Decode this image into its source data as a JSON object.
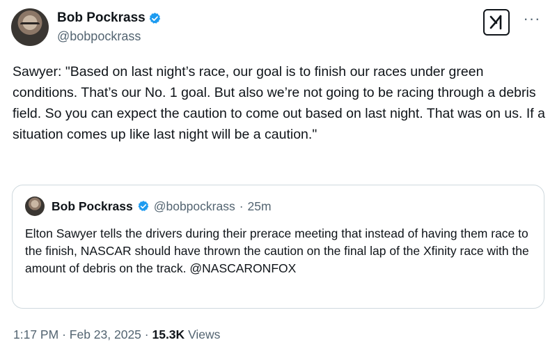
{
  "author": {
    "display_name": "Bob Pockrass",
    "handle": "@bobpockrass"
  },
  "tweet": {
    "text": "Sawyer: \"Based on last night’s race, our goal is to finish our races under green conditions. That’s our No. 1 goal. But also we’re not going to be racing through a debris field. So you can expect the caution to come out based on last night. That was on us. If a situation comes up like last night will be a caution.\""
  },
  "quoted_tweet": {
    "display_name": "Bob Pockrass",
    "handle": "@bobpockrass",
    "separator": "·",
    "time": "25m",
    "text": "Elton Sawyer tells the drivers during their prerace meeting that instead of having them race to the finish, NASCAR should have thrown the caution on the final lap of the Xfinity race with the amount of debris on the track. @NASCARONFOX"
  },
  "meta": {
    "time": "1:17 PM",
    "separator": "·",
    "date": "Feb 23, 2025",
    "views_count": "15.3K",
    "views_label": "Views"
  },
  "icons": {
    "verified": "verified-badge-icon",
    "grok": "grok-icon",
    "more": "more-icon"
  },
  "colors": {
    "verified": "#1d9bf0",
    "secondary_text": "#536471",
    "border": "#cfd9de"
  }
}
